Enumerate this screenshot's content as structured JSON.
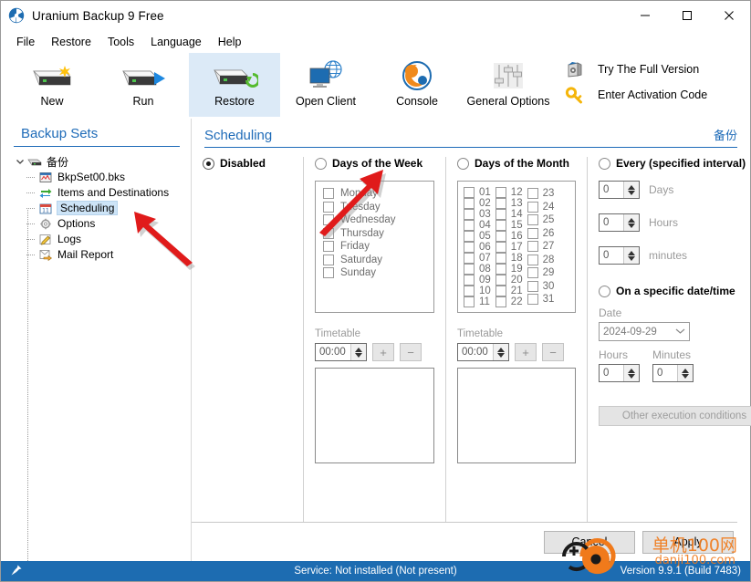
{
  "window": {
    "title": "Uranium Backup 9 Free",
    "app_icon": "radiation-icon",
    "minimize": "minimize-icon",
    "maximize": "maximize-icon",
    "close": "close-icon"
  },
  "menubar": {
    "items": [
      {
        "label": "File"
      },
      {
        "label": "Restore"
      },
      {
        "label": "Tools"
      },
      {
        "label": "Language"
      },
      {
        "label": "Help"
      }
    ]
  },
  "toolbar": {
    "buttons": [
      {
        "label": "New",
        "icon": "drive-new-icon",
        "selected": false
      },
      {
        "label": "Run",
        "icon": "drive-run-icon",
        "selected": false
      },
      {
        "label": "Restore",
        "icon": "drive-restore-icon",
        "selected": true
      },
      {
        "label": "Open Client",
        "icon": "monitor-globe-icon",
        "selected": false
      },
      {
        "label": "Console",
        "icon": "console-circle-icon",
        "selected": false
      },
      {
        "label": "General Options",
        "icon": "sliders-icon",
        "selected": false
      }
    ],
    "links": [
      {
        "label": "Try The Full Version",
        "icon": "box-icon"
      },
      {
        "label": "Enter Activation Code",
        "icon": "key-icon"
      }
    ]
  },
  "sidebar": {
    "title": "Backup Sets",
    "root": {
      "label": "备份",
      "icon": "drive-icon",
      "chevron": "chevron-down-icon"
    },
    "items": [
      {
        "label": "BkpSet00.bks",
        "icon": "bks-file-icon",
        "selected": false
      },
      {
        "label": "Items and Destinations",
        "icon": "transfer-icon",
        "selected": false
      },
      {
        "label": "Scheduling",
        "icon": "calendar-icon",
        "selected": true
      },
      {
        "label": "Options",
        "icon": "gear-icon",
        "selected": false
      },
      {
        "label": "Logs",
        "icon": "pencil-icon",
        "selected": false
      },
      {
        "label": "Mail Report",
        "icon": "mail-icon",
        "selected": false
      }
    ]
  },
  "content": {
    "title": "Scheduling",
    "right_label": "备份"
  },
  "scheduling": {
    "modes": [
      {
        "label": "Disabled",
        "selected": true
      },
      {
        "label": "Days of the Week",
        "selected": false
      },
      {
        "label": "Days of the Month",
        "selected": false
      },
      {
        "label": "Every (specified interval)",
        "selected": false
      }
    ],
    "week": {
      "days": [
        {
          "label": "Monday",
          "checked": false
        },
        {
          "label": "Tuesday",
          "checked": false
        },
        {
          "label": "Wednesday",
          "checked": false
        },
        {
          "label": "Thursday",
          "checked": false
        },
        {
          "label": "Friday",
          "checked": false
        },
        {
          "label": "Saturday",
          "checked": false
        },
        {
          "label": "Sunday",
          "checked": false
        }
      ],
      "timetable_label": "Timetable",
      "time_value": "00:00",
      "add_label": "+",
      "remove_label": "−"
    },
    "month": {
      "col1": [
        "01",
        "02",
        "03",
        "04",
        "05",
        "06",
        "07",
        "08",
        "09",
        "10",
        "11"
      ],
      "col2": [
        "12",
        "13",
        "14",
        "15",
        "16",
        "17",
        "18",
        "19",
        "20",
        "21",
        "22"
      ],
      "col3": [
        "23",
        "24",
        "25",
        "26",
        "27",
        "28",
        "29",
        "30",
        "31"
      ],
      "timetable_label": "Timetable",
      "time_value": "00:00",
      "add_label": "+",
      "remove_label": "−"
    },
    "interval": {
      "days": {
        "value": "0",
        "label": "Days"
      },
      "hours": {
        "value": "0",
        "label": "Hours"
      },
      "minutes": {
        "value": "0",
        "label": "minutes"
      }
    },
    "specific": {
      "radio_label": "On a specific date/time",
      "date_label": "Date",
      "date_value": "2024-09-29",
      "hours_label": "Hours",
      "hours_value": "0",
      "minutes_label": "Minutes",
      "minutes_value": "0",
      "other_conditions_label": "Other execution conditions"
    }
  },
  "footer": {
    "cancel_label": "Cancel",
    "apply_label": "Apply"
  },
  "statusbar": {
    "icon": "pin-icon",
    "service_text": "Service: Not installed (Not present)",
    "version_text": "Version 9.9.1 (Build 7483)"
  },
  "watermark": {
    "text": "单机100网",
    "subtext": "danji100.com"
  },
  "colors": {
    "accent_blue": "#1e6bb8",
    "status_blue": "#1d6cb1",
    "selection_blue": "#cde4f7",
    "toolbar_selected": "#dceaf7",
    "annotation_red": "#e01b1b",
    "watermark_orange": "#f07a1b"
  }
}
